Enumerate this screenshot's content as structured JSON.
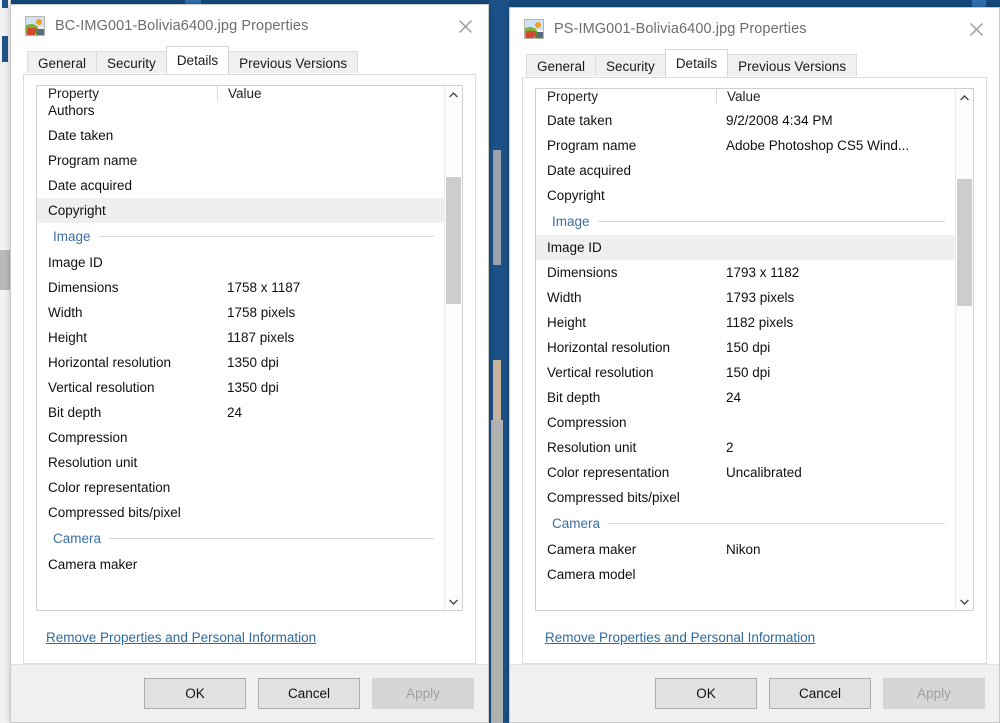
{
  "desktop": {
    "background_color": "#16497c",
    "accent_color": "#2f6fb0"
  },
  "windows": [
    {
      "id": "left",
      "title": "BC-IMG001-Bolivia6400.jpg Properties",
      "icon": "image-file-icon",
      "close_label": "Close",
      "tabs": [
        {
          "label": "General",
          "selected": false
        },
        {
          "label": "Security",
          "selected": false
        },
        {
          "label": "Details",
          "selected": true
        },
        {
          "label": "Previous Versions",
          "selected": false
        }
      ],
      "list": {
        "header": {
          "property": "Property",
          "value": "Value"
        },
        "rows": [
          {
            "type": "item",
            "property": "Authors",
            "value": "",
            "selected": false,
            "overlap": true
          },
          {
            "type": "item",
            "property": "Date taken",
            "value": "",
            "selected": false
          },
          {
            "type": "item",
            "property": "Program name",
            "value": "",
            "selected": false
          },
          {
            "type": "item",
            "property": "Date acquired",
            "value": "",
            "selected": false
          },
          {
            "type": "item",
            "property": "Copyright",
            "value": "",
            "selected": true
          },
          {
            "type": "group",
            "property": "Image"
          },
          {
            "type": "item",
            "property": "Image ID",
            "value": "",
            "selected": false
          },
          {
            "type": "item",
            "property": "Dimensions",
            "value": "1758 x 1187",
            "selected": false
          },
          {
            "type": "item",
            "property": "Width",
            "value": "1758 pixels",
            "selected": false
          },
          {
            "type": "item",
            "property": "Height",
            "value": "1187 pixels",
            "selected": false
          },
          {
            "type": "item",
            "property": "Horizontal resolution",
            "value": "1350 dpi",
            "selected": false
          },
          {
            "type": "item",
            "property": "Vertical resolution",
            "value": "1350 dpi",
            "selected": false
          },
          {
            "type": "item",
            "property": "Bit depth",
            "value": "24",
            "selected": false
          },
          {
            "type": "item",
            "property": "Compression",
            "value": "",
            "selected": false
          },
          {
            "type": "item",
            "property": "Resolution unit",
            "value": "",
            "selected": false
          },
          {
            "type": "item",
            "property": "Color representation",
            "value": "",
            "selected": false
          },
          {
            "type": "item",
            "property": "Compressed bits/pixel",
            "value": "",
            "selected": false
          },
          {
            "type": "group",
            "property": "Camera"
          },
          {
            "type": "item",
            "property": "Camera maker",
            "value": "",
            "selected": false
          }
        ],
        "scrollbar": {
          "thumb_top_pct": 15,
          "thumb_height_pct": 26
        }
      },
      "remove_link": "Remove Properties and Personal Information",
      "buttons": [
        {
          "label": "OK",
          "disabled": false
        },
        {
          "label": "Cancel",
          "disabled": false
        },
        {
          "label": "Apply",
          "disabled": true
        }
      ]
    },
    {
      "id": "right",
      "title": "PS-IMG001-Bolivia6400.jpg Properties",
      "icon": "image-file-icon",
      "close_label": "Close",
      "tabs": [
        {
          "label": "General",
          "selected": false
        },
        {
          "label": "Security",
          "selected": false
        },
        {
          "label": "Details",
          "selected": true
        },
        {
          "label": "Previous Versions",
          "selected": false
        }
      ],
      "list": {
        "header": {
          "property": "Property",
          "value": "Value"
        },
        "rows": [
          {
            "type": "item",
            "property": "Date taken",
            "value": "9/2/2008 4:34 PM",
            "selected": false
          },
          {
            "type": "item",
            "property": "Program name",
            "value": "Adobe Photoshop CS5 Wind...",
            "selected": false
          },
          {
            "type": "item",
            "property": "Date acquired",
            "value": "",
            "selected": false
          },
          {
            "type": "item",
            "property": "Copyright",
            "value": "",
            "selected": false
          },
          {
            "type": "group",
            "property": "Image"
          },
          {
            "type": "item",
            "property": "Image ID",
            "value": "",
            "selected": true
          },
          {
            "type": "item",
            "property": "Dimensions",
            "value": "1793 x 1182",
            "selected": false
          },
          {
            "type": "item",
            "property": "Width",
            "value": "1793 pixels",
            "selected": false
          },
          {
            "type": "item",
            "property": "Height",
            "value": "1182 pixels",
            "selected": false
          },
          {
            "type": "item",
            "property": "Horizontal resolution",
            "value": "150 dpi",
            "selected": false
          },
          {
            "type": "item",
            "property": "Vertical resolution",
            "value": "150 dpi",
            "selected": false
          },
          {
            "type": "item",
            "property": "Bit depth",
            "value": "24",
            "selected": false
          },
          {
            "type": "item",
            "property": "Compression",
            "value": "",
            "selected": false
          },
          {
            "type": "item",
            "property": "Resolution unit",
            "value": "2",
            "selected": false
          },
          {
            "type": "item",
            "property": "Color representation",
            "value": "Uncalibrated",
            "selected": false
          },
          {
            "type": "item",
            "property": "Compressed bits/pixel",
            "value": "",
            "selected": false
          },
          {
            "type": "group",
            "property": "Camera"
          },
          {
            "type": "item",
            "property": "Camera maker",
            "value": "Nikon",
            "selected": false
          },
          {
            "type": "item",
            "property": "Camera model",
            "value": "",
            "selected": false
          }
        ],
        "scrollbar": {
          "thumb_top_pct": 15,
          "thumb_height_pct": 26
        }
      },
      "remove_link": "Remove Properties and Personal Information",
      "buttons": [
        {
          "label": "OK",
          "disabled": false
        },
        {
          "label": "Cancel",
          "disabled": false
        },
        {
          "label": "Apply",
          "disabled": true
        }
      ]
    }
  ]
}
